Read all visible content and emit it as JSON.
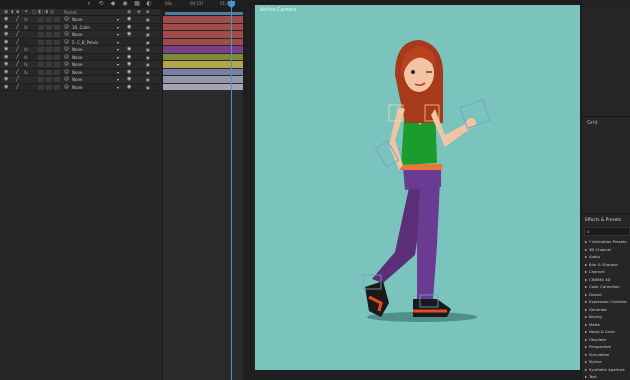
{
  "layer_panel": {
    "header": {
      "parent_label": "Parent"
    },
    "rows": [
      {
        "parent": "None",
        "eye_icon": "eye-icon"
      },
      {
        "parent": "16. Calm",
        "eye_icon": "eye-icon"
      },
      {
        "parent": "None",
        "eye_icon": "eye-icon"
      },
      {
        "parent": "5. C_B_Pelvis",
        "eye_icon": "eye-icon"
      },
      {
        "parent": "None",
        "eye_icon": "eye-icon"
      },
      {
        "parent": "None",
        "eye_icon": "eye-icon"
      },
      {
        "parent": "None",
        "eye_icon": "eye-icon"
      },
      {
        "parent": "None",
        "eye_icon": "eye-icon"
      },
      {
        "parent": "None",
        "eye_icon": "eye-icon"
      },
      {
        "parent": "None",
        "eye_icon": "eye-icon"
      }
    ]
  },
  "timeline": {
    "ruler_labels": [
      "00s",
      "00:15f",
      "01:0"
    ],
    "bar_colors": [
      "#a14b4b",
      "#a14b4b",
      "#a14b4b",
      "#a14b4b",
      "#7b3f8a",
      "#7d8a3a",
      "#b5a54a",
      "#7d7ea8",
      "#8f97a8",
      "#a6a3b4"
    ]
  },
  "viewer": {
    "label": "Active Camera",
    "background_color": "#7bc4be"
  },
  "right_panel": {
    "middle_title": "Grid",
    "effects": {
      "title": "Effects & Presets",
      "search_icon": "search-icon",
      "items": [
        "* Animation Presets",
        "3D Channel",
        "Audio",
        "Blur & Sharpen",
        "Channel",
        "CINEMA 4D",
        "Color Correction",
        "Distort",
        "Expression Controls",
        "Generate",
        "Keying",
        "Matte",
        "Noise & Grain",
        "Obsolete",
        "Perspective",
        "Simulation",
        "Stylize",
        "Synthetic Aperture",
        "Text"
      ]
    }
  }
}
